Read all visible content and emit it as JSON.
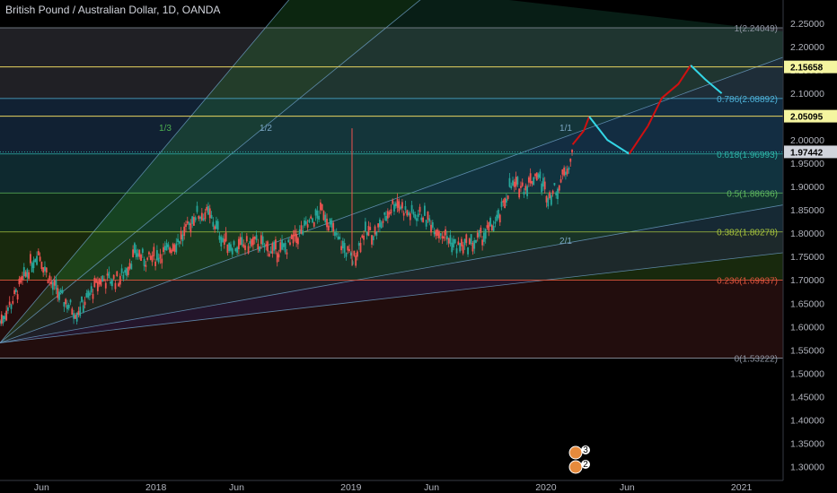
{
  "title": "British Pound / Australian Dollar, 1D, OANDA",
  "colors": {
    "background": "#000000",
    "bull": "#26a69a",
    "bear": "#ef5350",
    "axis_text": "#b2b5be",
    "highlight_box": "#f5f5a0",
    "current_price_box": "#d1d4dc",
    "projection_up": "#d01010",
    "projection_down": "#33d6e6"
  },
  "chart_data": {
    "type": "candlestick",
    "symbol": "GBPAUD",
    "timeframe": "1D",
    "source": "OANDA",
    "ylim": [
      1.27,
      2.3
    ],
    "yticks": [
      2.25,
      2.2,
      2.15,
      2.1,
      2.05,
      2.0,
      1.95,
      1.9,
      1.85,
      1.8,
      1.75,
      1.7,
      1.65,
      1.6,
      1.55,
      1.5,
      1.45,
      1.4,
      1.35,
      1.3
    ],
    "xlim": [
      "2017-03-15",
      "2021-03-20"
    ],
    "xticks": [
      {
        "date": "2017-06-01",
        "label": "Jun"
      },
      {
        "date": "2018-01-01",
        "label": "2018"
      },
      {
        "date": "2018-06-01",
        "label": "Jun"
      },
      {
        "date": "2019-01-01",
        "label": "2019"
      },
      {
        "date": "2019-06-01",
        "label": "Jun"
      },
      {
        "date": "2020-01-01",
        "label": "2020"
      },
      {
        "date": "2020-06-01",
        "label": "Jun"
      },
      {
        "date": "2021-01-01",
        "label": "2021"
      }
    ],
    "price_path": [
      [
        "2017-03-15",
        1.61
      ],
      [
        "2017-04-10",
        1.66
      ],
      [
        "2017-05-15",
        1.74
      ],
      [
        "2017-05-25",
        1.76
      ],
      [
        "2017-06-20",
        1.69
      ],
      [
        "2017-07-10",
        1.66
      ],
      [
        "2017-08-05",
        1.63
      ],
      [
        "2017-08-25",
        1.66
      ],
      [
        "2017-09-20",
        1.7
      ],
      [
        "2017-10-25",
        1.7
      ],
      [
        "2017-11-25",
        1.76
      ],
      [
        "2017-12-15",
        1.74
      ],
      [
        "2018-01-20",
        1.76
      ],
      [
        "2018-02-25",
        1.8
      ],
      [
        "2018-03-15",
        1.84
      ],
      [
        "2018-04-10",
        1.84
      ],
      [
        "2018-05-10",
        1.78
      ],
      [
        "2018-06-05",
        1.77
      ],
      [
        "2018-07-10",
        1.78
      ],
      [
        "2018-08-10",
        1.76
      ],
      [
        "2018-09-05",
        1.77
      ],
      [
        "2018-10-15",
        1.82
      ],
      [
        "2018-11-10",
        1.85
      ],
      [
        "2018-12-05",
        1.79
      ],
      [
        "2018-12-25",
        1.76
      ],
      [
        "2019-01-05",
        1.74
      ],
      [
        "2019-01-25",
        1.8
      ],
      [
        "2019-02-15",
        1.8
      ],
      [
        "2019-03-10",
        1.84
      ],
      [
        "2019-03-25",
        1.87
      ],
      [
        "2019-04-20",
        1.84
      ],
      [
        "2019-05-15",
        1.84
      ],
      [
        "2019-06-10",
        1.81
      ],
      [
        "2019-07-20",
        1.77
      ],
      [
        "2019-08-20",
        1.78
      ],
      [
        "2019-09-10",
        1.8
      ],
      [
        "2019-10-05",
        1.83
      ],
      [
        "2019-10-25",
        1.9
      ],
      [
        "2019-11-25",
        1.9
      ],
      [
        "2019-12-15",
        1.93
      ],
      [
        "2020-01-05",
        1.88
      ],
      [
        "2020-01-25",
        1.9
      ],
      [
        "2020-02-05",
        1.93
      ],
      [
        "2020-02-20",
        1.97
      ]
    ],
    "spike": {
      "date": "2019-01-03",
      "high": 2.025,
      "low": 1.73
    },
    "pitchfan_labels": [
      "1/3",
      "1/2",
      "1/1",
      "2/1"
    ],
    "fib_levels": [
      {
        "ratio": "1",
        "price": 2.24049,
        "label": "1(2.24049)",
        "color": "#8d93a0"
      },
      {
        "ratio": "0.786",
        "price": 2.08892,
        "label": "0.786(2.08892)",
        "color": "#4fb3d9"
      },
      {
        "ratio": "0.618",
        "price": 1.96993,
        "label": "0.618(1.96993)",
        "color": "#2db3a6"
      },
      {
        "ratio": "0.5",
        "price": 1.88636,
        "label": "0.5(1.88636)",
        "color": "#5fb85f"
      },
      {
        "ratio": "0.382",
        "price": 1.80278,
        "label": "0.382(1.80278)",
        "color": "#a6c23c"
      },
      {
        "ratio": "0.236",
        "price": 1.69937,
        "label": "0.236(1.69937)",
        "color": "#e0553c"
      },
      {
        "ratio": "0",
        "price": 1.53222,
        "label": "0(1.53222)",
        "color": "#8d93a0"
      }
    ],
    "horizontal_levels": [
      {
        "price": 2.15658,
        "label": "2.15658"
      },
      {
        "price": 2.05095,
        "label": "2.05095"
      }
    ],
    "current_price": {
      "price": 1.97442,
      "label": "1.97442"
    },
    "projection": [
      [
        "2020-02-20",
        1.99
      ],
      [
        "2020-03-12",
        2.02
      ],
      [
        "2020-03-22",
        2.05
      ],
      [
        "2020-04-25",
        2.0
      ],
      [
        "2020-06-05",
        1.97
      ],
      [
        "2020-07-10",
        2.03
      ],
      [
        "2020-08-05",
        2.09
      ],
      [
        "2020-09-05",
        2.12
      ],
      [
        "2020-09-28",
        2.16
      ],
      [
        "2020-10-25",
        2.13
      ],
      [
        "2020-11-25",
        2.1
      ]
    ],
    "events": [
      {
        "label": "3"
      },
      {
        "label": "2"
      }
    ]
  }
}
